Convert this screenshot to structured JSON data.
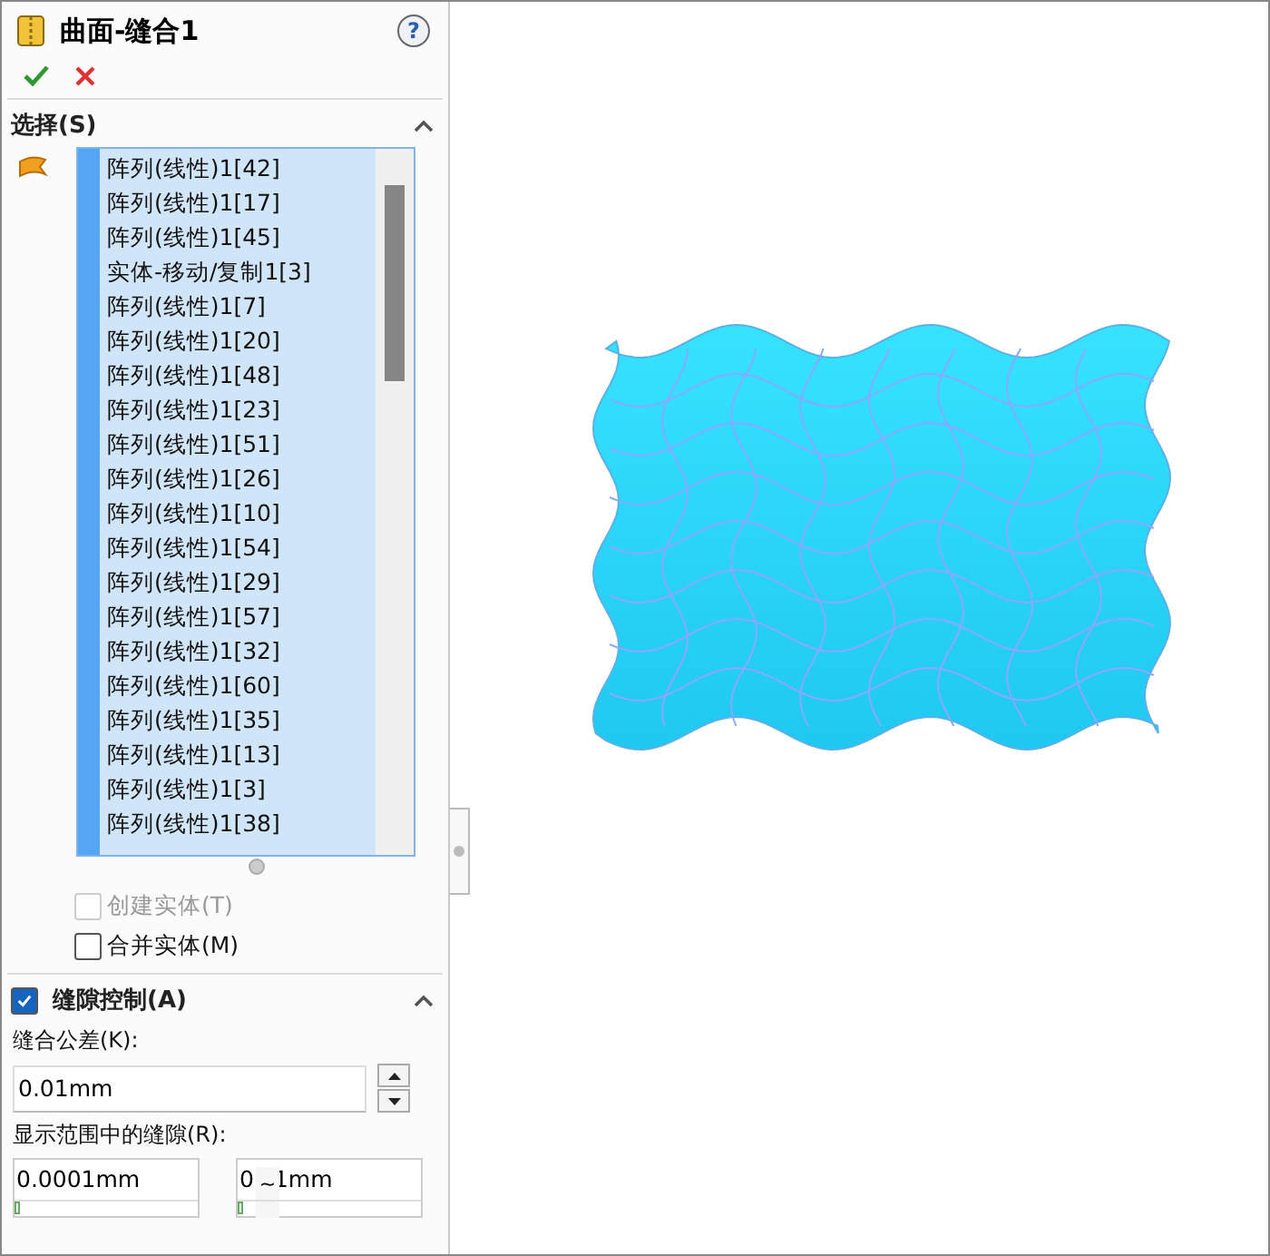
{
  "panel": {
    "title": "曲面-缝合1",
    "help": "?",
    "actions": [
      {
        "kind": "ok"
      },
      {
        "kind": "cancel"
      }
    ]
  },
  "selection": {
    "title": "选择(S)",
    "expanded": true,
    "items": [
      "阵列(线性)1[42]",
      "阵列(线性)1[17]",
      "阵列(线性)1[45]",
      "实体-移动/复制1[3]",
      "阵列(线性)1[7]",
      "阵列(线性)1[20]",
      "阵列(线性)1[48]",
      "阵列(线性)1[23]",
      "阵列(线性)1[51]",
      "阵列(线性)1[26]",
      "阵列(线性)1[10]",
      "阵列(线性)1[54]",
      "阵列(线性)1[29]",
      "阵列(线性)1[57]",
      "阵列(线性)1[32]",
      "阵列(线性)1[60]",
      "阵列(线性)1[35]",
      "阵列(线性)1[13]",
      "阵列(线性)1[3]",
      "阵列(线性)1[38]"
    ],
    "options": [
      {
        "label": "创建实体(T)",
        "checked": false,
        "disabled": true
      },
      {
        "label": "合并实体(M)",
        "checked": false,
        "disabled": false
      }
    ]
  },
  "gap_control": {
    "title": "缝隙控制(A)",
    "checked": true,
    "expanded": true,
    "tolerance_label": "缝合公差(K):",
    "tolerance": "0.01mm",
    "range_label": "显示范围中的缝隙(R):",
    "range_min": {
      "value": "0.0001mm",
      "level": 0
    },
    "range_max": {
      "value_parts": [
        "0",
        "1mm"
      ],
      "separator": "~",
      "level": 0
    }
  }
}
